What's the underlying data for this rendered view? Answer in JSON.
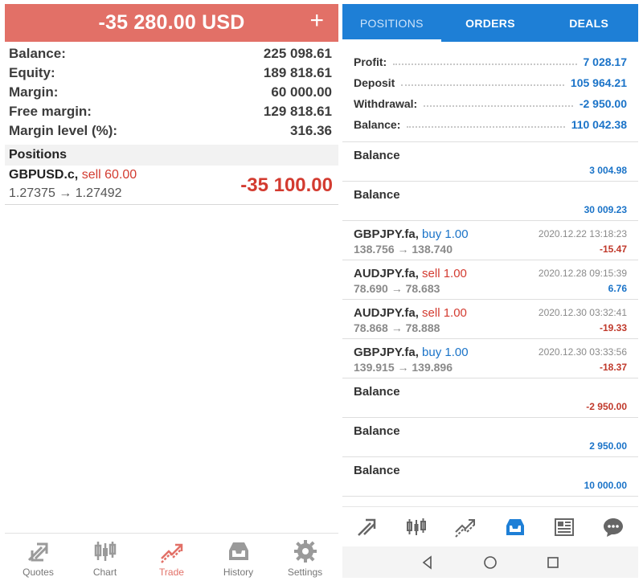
{
  "left": {
    "header": {
      "title": "-35 280.00 USD",
      "plus": "+"
    },
    "account": [
      {
        "label": "Balance:",
        "value": "225 098.61"
      },
      {
        "label": "Equity:",
        "value": "189 818.61"
      },
      {
        "label": "Margin:",
        "value": "60 000.00"
      },
      {
        "label": "Free margin:",
        "value": "129 818.61"
      },
      {
        "label": "Margin level (%):",
        "value": "316.36"
      }
    ],
    "positions_header": "Positions",
    "position": {
      "symbol": "GBPUSD.c,",
      "side": "sell 60.00",
      "prices": "1.27375 → 1.27492",
      "profit": "-35 100.00"
    },
    "nav": [
      {
        "label": "Quotes",
        "icon": "quotes-icon"
      },
      {
        "label": "Chart",
        "icon": "chart-icon"
      },
      {
        "label": "Trade",
        "icon": "trade-icon"
      },
      {
        "label": "History",
        "icon": "history-icon"
      },
      {
        "label": "Settings",
        "icon": "settings-icon"
      }
    ],
    "active_color": "#e27067",
    "header_color": "#e27067"
  },
  "right": {
    "tabs": [
      "POSITIONS",
      "ORDERS",
      "DEALS"
    ],
    "tab_color": "#1e7fd6",
    "summary": [
      {
        "label": "Profit:",
        "value": "7 028.17"
      },
      {
        "label": "Deposit",
        "value": "105 964.21"
      },
      {
        "label": "Withdrawal:",
        "value": "-2 950.00"
      },
      {
        "label": "Balance:",
        "value": "110 042.38"
      }
    ],
    "deals": [
      {
        "type": "balance",
        "title": "Balance",
        "amount": "3 004.98",
        "sign": "pos"
      },
      {
        "type": "balance",
        "title": "Balance",
        "amount": "30 009.23",
        "sign": "pos"
      },
      {
        "type": "trade",
        "symbol": "GBPJPY.fa,",
        "side": "buy 1.00",
        "side_class": "buy",
        "prices": "138.756 → 138.740",
        "time": "2020.12.22 13:18:23",
        "amount": "-15.47",
        "sign": "neg"
      },
      {
        "type": "trade",
        "symbol": "AUDJPY.fa,",
        "side": "sell 1.00",
        "side_class": "sell",
        "prices": "78.690 → 78.683",
        "time": "2020.12.28 09:15:39",
        "amount": "6.76",
        "sign": "pos"
      },
      {
        "type": "trade",
        "symbol": "AUDJPY.fa,",
        "side": "sell 1.00",
        "side_class": "sell",
        "prices": "78.868 → 78.888",
        "time": "2020.12.30 03:32:41",
        "amount": "-19.33",
        "sign": "neg"
      },
      {
        "type": "trade",
        "symbol": "GBPJPY.fa,",
        "side": "buy 1.00",
        "side_class": "buy",
        "prices": "139.915 → 139.896",
        "time": "2020.12.30 03:33:56",
        "amount": "-18.37",
        "sign": "neg"
      },
      {
        "type": "balance",
        "title": "Balance",
        "amount": "-2 950.00",
        "sign": "neg"
      },
      {
        "type": "balance",
        "title": "Balance",
        "amount": "2 950.00",
        "sign": "pos"
      },
      {
        "type": "balance",
        "title": "Balance",
        "amount": "10 000.00",
        "sign": "pos"
      }
    ],
    "bottom_nav_icons": [
      "trade-arrow-icon",
      "candles-icon",
      "chart-line-icon",
      "inbox-icon",
      "news-icon",
      "chat-icon"
    ],
    "android_nav_icons": [
      "back-icon",
      "home-icon",
      "recents-icon"
    ]
  }
}
